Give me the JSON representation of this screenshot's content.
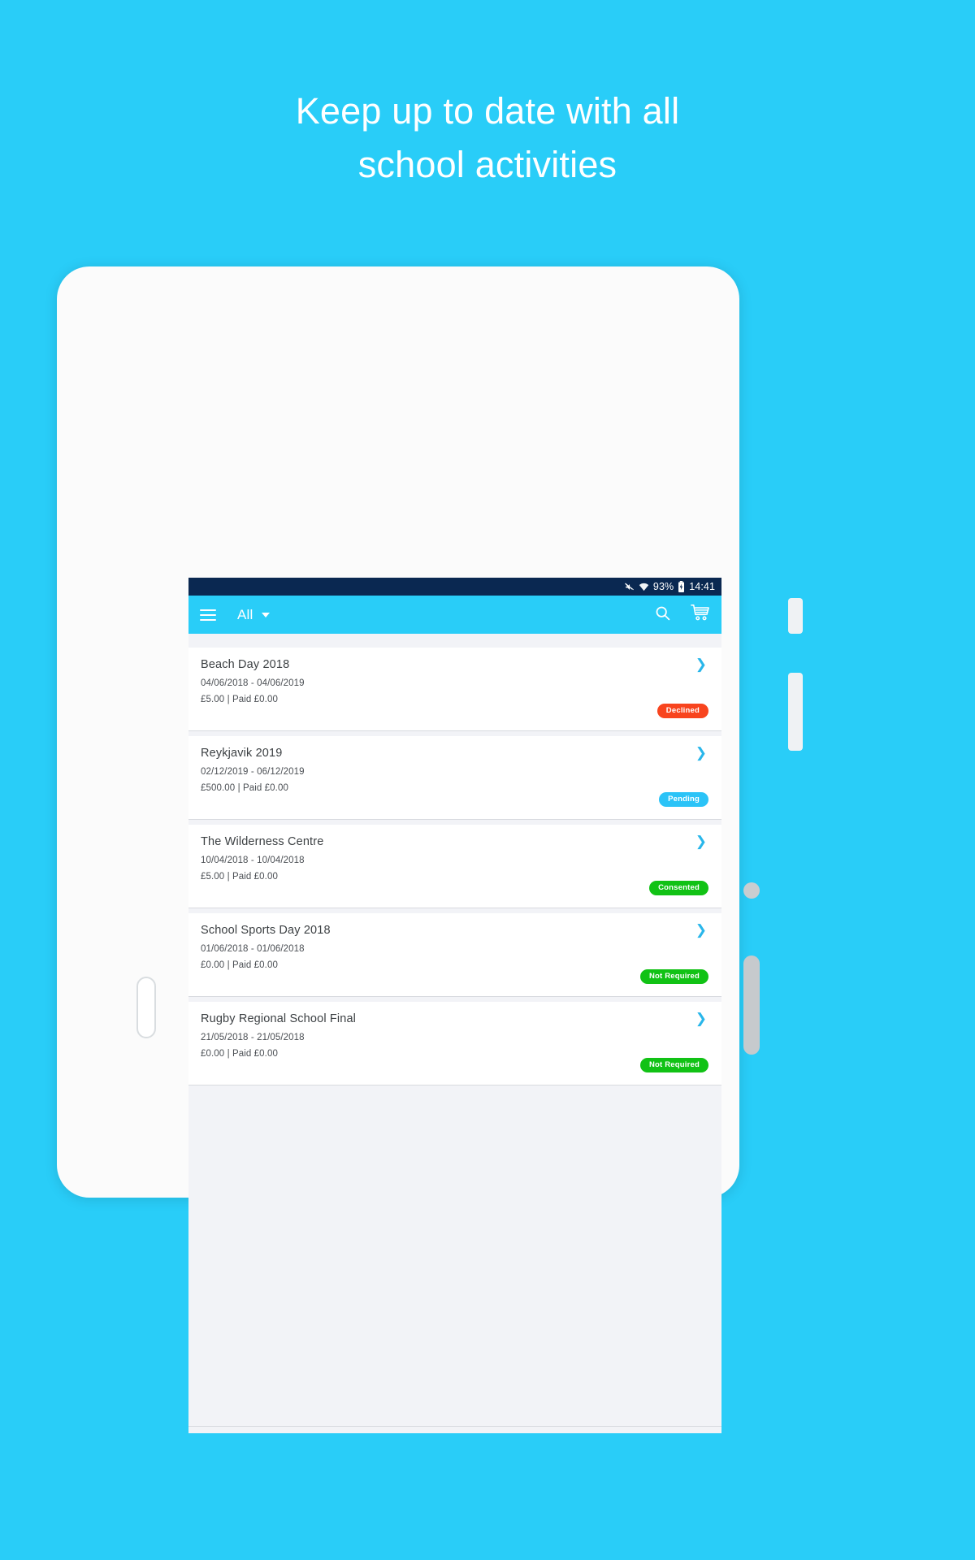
{
  "promo": {
    "headline_line1": "Keep up to date with all",
    "headline_line2": "school activities",
    "background_color": "#29CDF8",
    "text_color": "#FFFFFF"
  },
  "statusbar": {
    "mute_icon": "mute-icon",
    "wifi_icon": "wifi-icon",
    "battery_percent": "93%",
    "battery_icon": "battery-icon",
    "time": "14:41",
    "background_color": "#0A2851"
  },
  "appbar": {
    "menu_icon": "hamburger-menu-icon",
    "filter_label": "All",
    "caret_icon": "chevron-down-icon",
    "search_icon": "search-icon",
    "cart_icon": "shopping-cart-icon",
    "background_color": "#29CDF8"
  },
  "list": {
    "items": [
      {
        "title": "Beach Day 2018",
        "dates": "04/06/2018 - 04/06/2019",
        "price": "£5.00 | Paid £0.00",
        "status": "Declined",
        "status_color": "#F8441E",
        "chevron": "❯"
      },
      {
        "title": "Reykjavik 2019",
        "dates": "02/12/2019 - 06/12/2019",
        "price": "£500.00 | Paid £0.00",
        "status": "Pending",
        "status_color": "#2BC3F7",
        "chevron": "❯"
      },
      {
        "title": "The Wilderness Centre",
        "dates": "10/04/2018 - 10/04/2018",
        "price": "£5.00 | Paid £0.00",
        "status": "Consented",
        "status_color": "#11C215",
        "chevron": "❯"
      },
      {
        "title": "School Sports Day 2018",
        "dates": "01/06/2018 - 01/06/2018",
        "price": "£0.00 | Paid £0.00",
        "status": "Not Required",
        "status_color": "#11C215",
        "chevron": "❯"
      },
      {
        "title": "Rugby Regional School Final",
        "dates": "21/05/2018 - 21/05/2018",
        "price": "£0.00 | Paid £0.00",
        "status": "Not Required",
        "status_color": "#11C215",
        "chevron": "❯"
      }
    ]
  }
}
